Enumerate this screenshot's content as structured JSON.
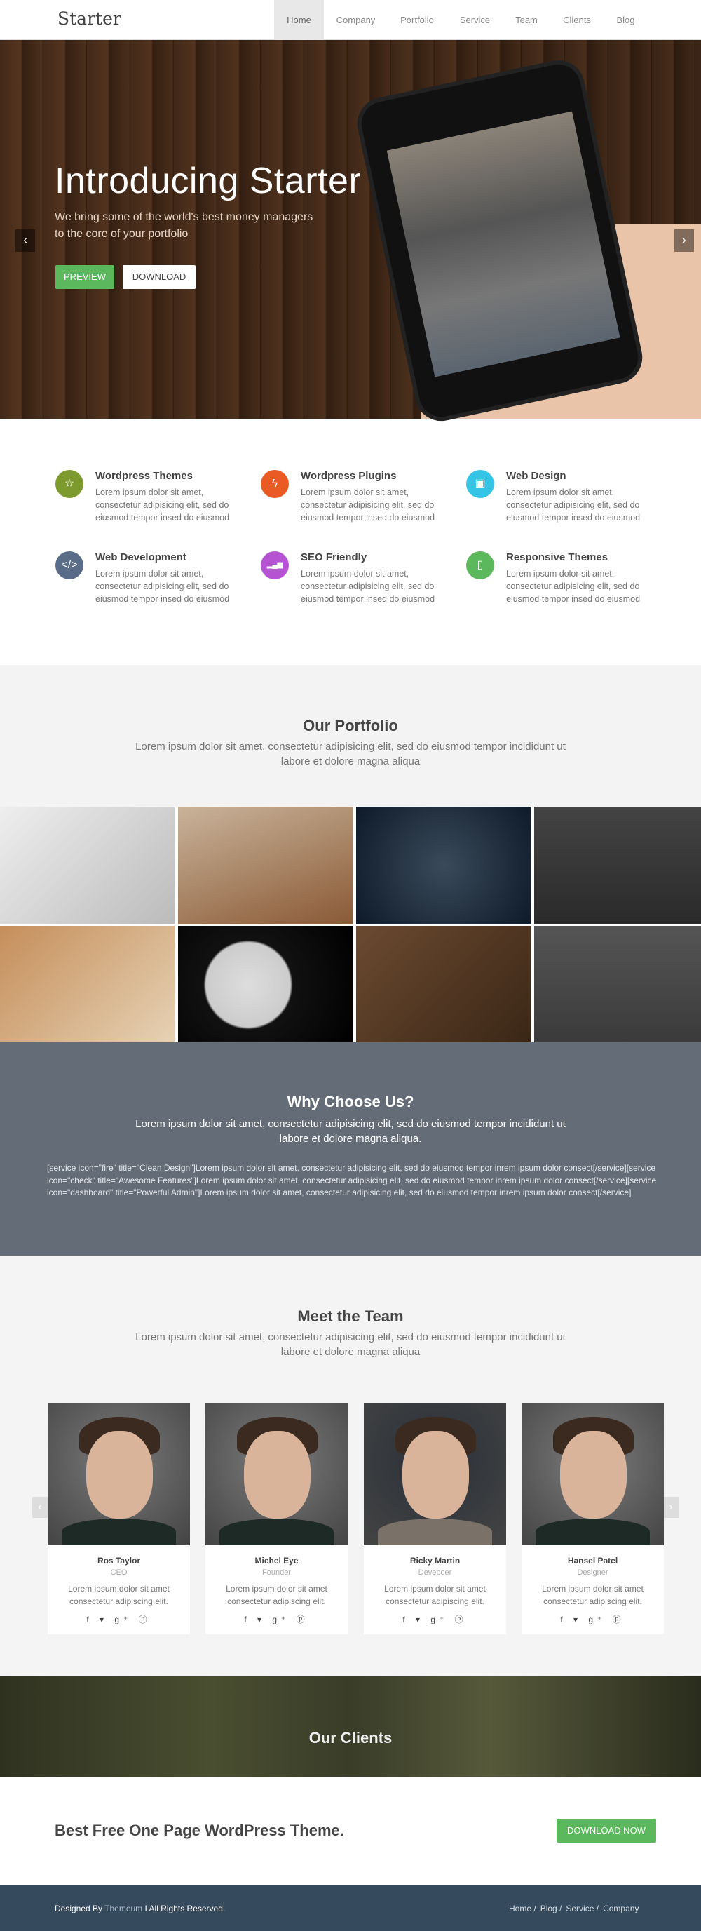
{
  "nav": {
    "logo": "Starter",
    "items": [
      "Home",
      "Company",
      "Portfolio",
      "Service",
      "Team",
      "Clients",
      "Blog"
    ],
    "active": "Home"
  },
  "hero": {
    "title": "Introducing Starter",
    "subtitle_line1": "We bring some of the world's best money managers",
    "subtitle_line2": "to the core of your portfolio",
    "preview_label": "PREVIEW",
    "download_label": "DOWNLOAD",
    "prev_icon": "‹",
    "next_icon": "›"
  },
  "features": [
    {
      "title": "Wordpress Themes",
      "text": "Lorem ipsum dolor sit amet, consectetur adipisicing elit, sed do eiusmod tempor insed do eiusmod",
      "icon": "star-icon",
      "glyph": "☆",
      "color": "#7d9a2e"
    },
    {
      "title": "Wordpress Plugins",
      "text": "Lorem ipsum dolor sit amet, consectetur adipisicing elit, sed do eiusmod tempor insed do eiusmod",
      "icon": "bolt-icon",
      "glyph": "ϟ",
      "color": "#ea5a24"
    },
    {
      "title": "Web Design",
      "text": "Lorem ipsum dolor sit amet, consectetur adipisicing elit, sed do eiusmod tempor insed do eiusmod",
      "icon": "gift-icon",
      "glyph": "▣",
      "color": "#36c4e6"
    },
    {
      "title": "Web Development",
      "text": "Lorem ipsum dolor sit amet, consectetur adipisicing elit, sed do eiusmod tempor insed do eiusmod",
      "icon": "code-icon",
      "glyph": "</>",
      "color": "#5a6d88"
    },
    {
      "title": "SEO Friendly",
      "text": "Lorem ipsum dolor sit amet, consectetur adipisicing elit, sed do eiusmod tempor insed do eiusmod",
      "icon": "signal-icon",
      "glyph": "▂▄▆",
      "color": "#b553d3"
    },
    {
      "title": "Responsive Themes",
      "text": "Lorem ipsum dolor sit amet, consectetur adipisicing elit, sed do eiusmod tempor insed do eiusmod",
      "icon": "tablet-icon",
      "glyph": "▯",
      "color": "#5cb85c"
    }
  ],
  "portfolio": {
    "title": "Our Portfolio",
    "subtitle": "Lorem ipsum dolor sit amet, consectetur adipisicing elit, sed do eiusmod tempor incididunt ut labore et dolore magna aliqua"
  },
  "why": {
    "title": "Why Choose Us?",
    "subtitle": "Lorem ipsum dolor sit amet, consectetur adipisicing elit, sed do eiusmod tempor incididunt ut labore et dolore magna aliqua.",
    "body": "[service icon=\"fire\" title=\"Clean Design\"]Lorem ipsum dolor sit amet, consectetur adipisicing elit, sed do eiusmod tempor inrem ipsum dolor consect[/service][service icon=\"check\" title=\"Awesome Features\"]Lorem ipsum dolor sit amet, consectetur adipisicing elit, sed do eiusmod tempor inrem ipsum dolor consect[/service][service icon=\"dashboard\" title=\"Powerful Admin\"]Lorem ipsum dolor sit amet, consectetur adipisicing elit, sed do eiusmod tempor inrem ipsum dolor consect[/service]"
  },
  "team": {
    "title": "Meet the Team",
    "subtitle": "Lorem ipsum dolor sit amet, consectetur adipisicing elit, sed do eiusmod tempor incididunt ut labore et dolore magna aliqua",
    "social": "f ▾ g⁺ ⓟ",
    "members": [
      {
        "name": "Ros Taylor",
        "role": "CEO",
        "text": "Lorem ipsum dolor sit amet consectetur adipiscing elit."
      },
      {
        "name": "Michel Eye",
        "role": "Founder",
        "text": "Lorem ipsum dolor sit amet consectetur adipiscing elit."
      },
      {
        "name": "Ricky Martin",
        "role": "Devepoer",
        "text": "Lorem ipsum dolor sit amet consectetur adipiscing elit."
      },
      {
        "name": "Hansel Patel",
        "role": "Designer",
        "text": "Lorem ipsum dolor sit amet consectetur adipiscing elit."
      }
    ]
  },
  "clients": {
    "title": "Our Clients"
  },
  "cta": {
    "title": "Best Free One Page WordPress Theme.",
    "button": "DOWNLOAD NOW"
  },
  "footer": {
    "designed_by": "Designed By ",
    "brand": "Themeum",
    "rights": " I All Rights Reserved.",
    "links": [
      "Home /",
      "Blog /",
      "Service /",
      "Company"
    ]
  }
}
